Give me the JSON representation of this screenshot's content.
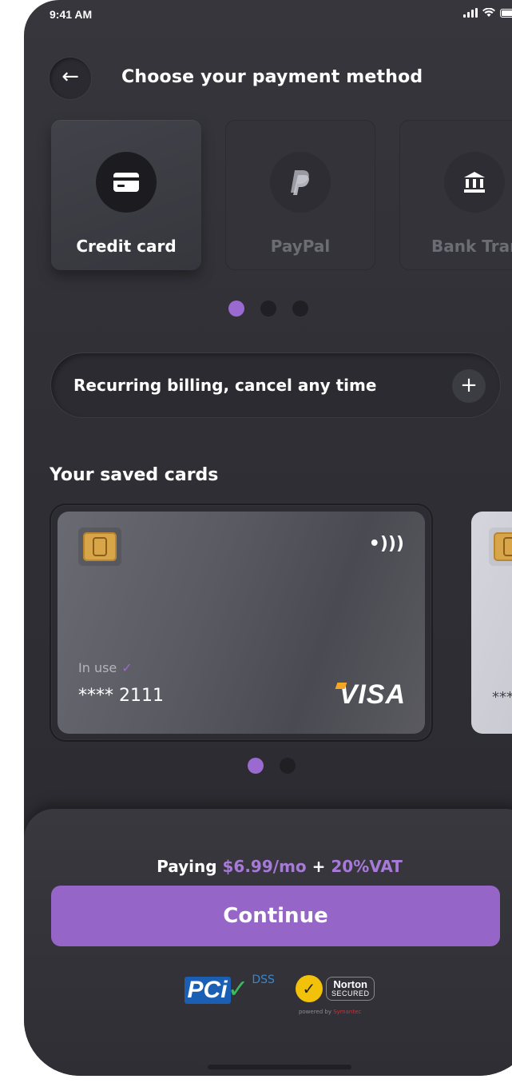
{
  "status": {
    "time": "9:41 AM"
  },
  "header": {
    "title": "Choose your payment method"
  },
  "methods": [
    {
      "label": "Credit card",
      "icon": "credit-card-icon",
      "active": true
    },
    {
      "label": "PayPal",
      "icon": "paypal-icon",
      "active": false
    },
    {
      "label": "Bank Trar",
      "icon": "bank-icon",
      "active": false
    }
  ],
  "method_pager": {
    "count": 3,
    "active": 0
  },
  "recurring": {
    "label": "Recurring billing, cancel any time",
    "icon": "plus-icon"
  },
  "saved": {
    "title": "Your saved cards",
    "cards": [
      {
        "status": "In use",
        "number": "**** 2111",
        "brand": "VISA"
      },
      {
        "number": "****"
      }
    ],
    "pager": {
      "count": 2,
      "active": 0
    }
  },
  "summary": {
    "paying_label": "Paying",
    "price": "$6.99/mo",
    "plus": "+",
    "vat": "20%VAT"
  },
  "continue_label": "Continue",
  "badges": {
    "pci": {
      "text": "PCi",
      "sub": "DSS"
    },
    "norton": {
      "line1": "Norton",
      "line2": "SECURED",
      "powered_prefix": "powered by",
      "powered_brand": "Symantec"
    }
  },
  "colors": {
    "accent": "#9a6ad1",
    "background": "#2f2f35",
    "card_chip": "#d8a649"
  }
}
